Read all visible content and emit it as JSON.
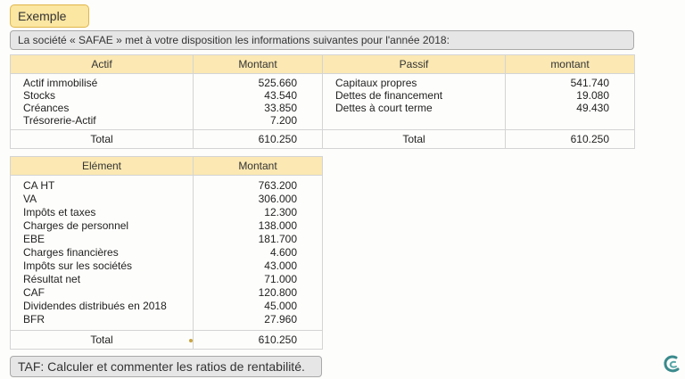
{
  "header": {
    "label": "Exemple"
  },
  "intro": {
    "text": "La société « SAFAE » met à votre disposition les informations suivantes pour l'année 2018:"
  },
  "bilan": {
    "headers": {
      "actif": "Actif",
      "montant_actif": "Montant",
      "passif": "Passif",
      "montant_passif": "montant"
    },
    "actif": [
      {
        "label": "Actif immobilisé",
        "value": "525.660"
      },
      {
        "label": "Stocks",
        "value": "43.540"
      },
      {
        "label": "Créances",
        "value": "33.850"
      },
      {
        "label": "Trésorerie-Actif",
        "value": "7.200"
      }
    ],
    "passif": [
      {
        "label": "Capitaux propres",
        "value": "541.740"
      },
      {
        "label": "Dettes de financement",
        "value": "19.080"
      },
      {
        "label": "Dettes à court terme",
        "value": "49.430"
      }
    ],
    "total_actif": {
      "label": "Total",
      "value": "610.250"
    },
    "total_passif": {
      "label": "Total",
      "value": "610.250"
    }
  },
  "elements": {
    "headers": {
      "element": "Elément",
      "montant": "Montant"
    },
    "rows": [
      {
        "label": "CA HT",
        "value": "763.200"
      },
      {
        "label": "VA",
        "value": "306.000"
      },
      {
        "label": "Impôts et taxes",
        "value": "12.300"
      },
      {
        "label": "Charges de personnel",
        "value": "138.000"
      },
      {
        "label": "EBE",
        "value": "181.700"
      },
      {
        "label": "Charges financières",
        "value": "4.600"
      },
      {
        "label": "Impôts sur les sociétés",
        "value": "43.000"
      },
      {
        "label": "Résultat net",
        "value": "71.000"
      },
      {
        "label": "CAF",
        "value": "120.800"
      },
      {
        "label": "Dividendes distribués en 2018",
        "value": "45.000"
      },
      {
        "label": "BFR",
        "value": "27.960"
      }
    ],
    "total": {
      "label": "Total",
      "value": "610.250"
    }
  },
  "taf": {
    "text": "TAF: Calculer et commenter les ratios de rentabilité."
  },
  "colors": {
    "header_bg": "#fbe8b2",
    "label_bg": "#fbe6a2",
    "box_bg": "#e6e6e6",
    "logo": "#3a8a8c"
  },
  "icons": {
    "logo": "channel-logo-icon"
  }
}
